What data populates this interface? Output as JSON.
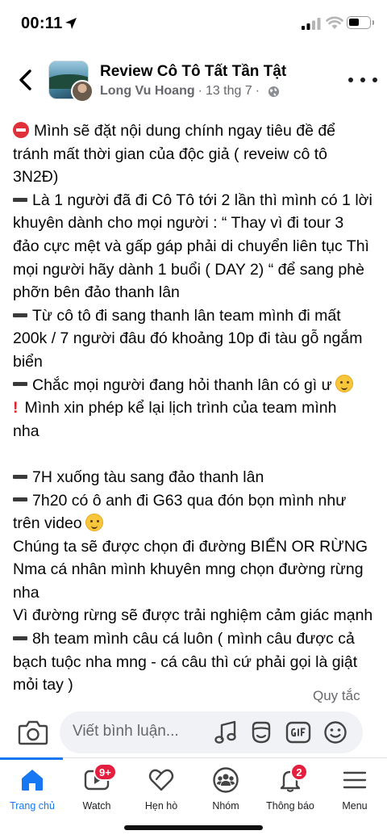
{
  "status_bar": {
    "time": "00:11"
  },
  "header": {
    "group_name": "Review Cô Tô Tất Tần Tật",
    "author": "Long Vu Hoang",
    "separator": "·",
    "date": "13 thg 7",
    "separator2": "·"
  },
  "post": {
    "lines": [
      "Mình sẽ đặt nội dung chính ngay tiêu đề để",
      "tránh mất thời gian của độc giả ( reveiw cô tô",
      "3N2Đ)",
      "Là 1 người đã đi Cô Tô tới 2 lần thì mình có 1 lời",
      "khuyên dành cho mọi người : “ Thay vì đi tour 3",
      "đảo cực mệt và gấp gáp phải di chuyển liên tục Thì",
      "mọi người hãy dành 1 buổi ( DAY 2) “ để sang phè",
      "phỡn bên đảo thanh lân",
      "Từ cô tô đi sang thanh lân team mình đi mất",
      "200k / 7 người  đâu đó khoảng 10p đi tàu gỗ ngắm",
      "biển",
      "Chắc mọi người đang hỏi thanh lân có gì ư",
      "Mình xin phép kể lại lịch trình của team mình",
      "nha",
      "",
      "7H xuống tàu sang đảo thanh lân",
      "7h20 có ô anh đi G63 qua đón bọn mình như",
      "trên video",
      "Chúng ta sẽ được chọn đi đường BIỂN OR RỪNG",
      "Nma cá nhân mình khuyên mng chọn đường rừng",
      "nha",
      "Vì đường rừng sẽ được trải nghiệm cảm giác mạnh",
      "8h team mình câu cá luôn ( mình câu được cả",
      "bạch tuộc nha mng - cá câu thì cứ phải gọi là giật",
      "mỏi tay )"
    ],
    "excl_mark": "!"
  },
  "rules_link": "Quy tắc",
  "composer": {
    "placeholder": "Viết bình luận..."
  },
  "tabs": [
    {
      "label": "Trang chủ",
      "icon": "home-icon"
    },
    {
      "label": "Watch",
      "icon": "watch-icon",
      "badge": "9+"
    },
    {
      "label": "Hẹn hò",
      "icon": "dating-heart-icon"
    },
    {
      "label": "Nhóm",
      "icon": "groups-icon"
    },
    {
      "label": "Thông báo",
      "icon": "bell-icon",
      "badge": "2"
    },
    {
      "label": "Menu",
      "icon": "menu-icon"
    }
  ],
  "colors": {
    "accent": "#1877f2",
    "badge": "#e41e3f",
    "muted": "#65676b"
  }
}
